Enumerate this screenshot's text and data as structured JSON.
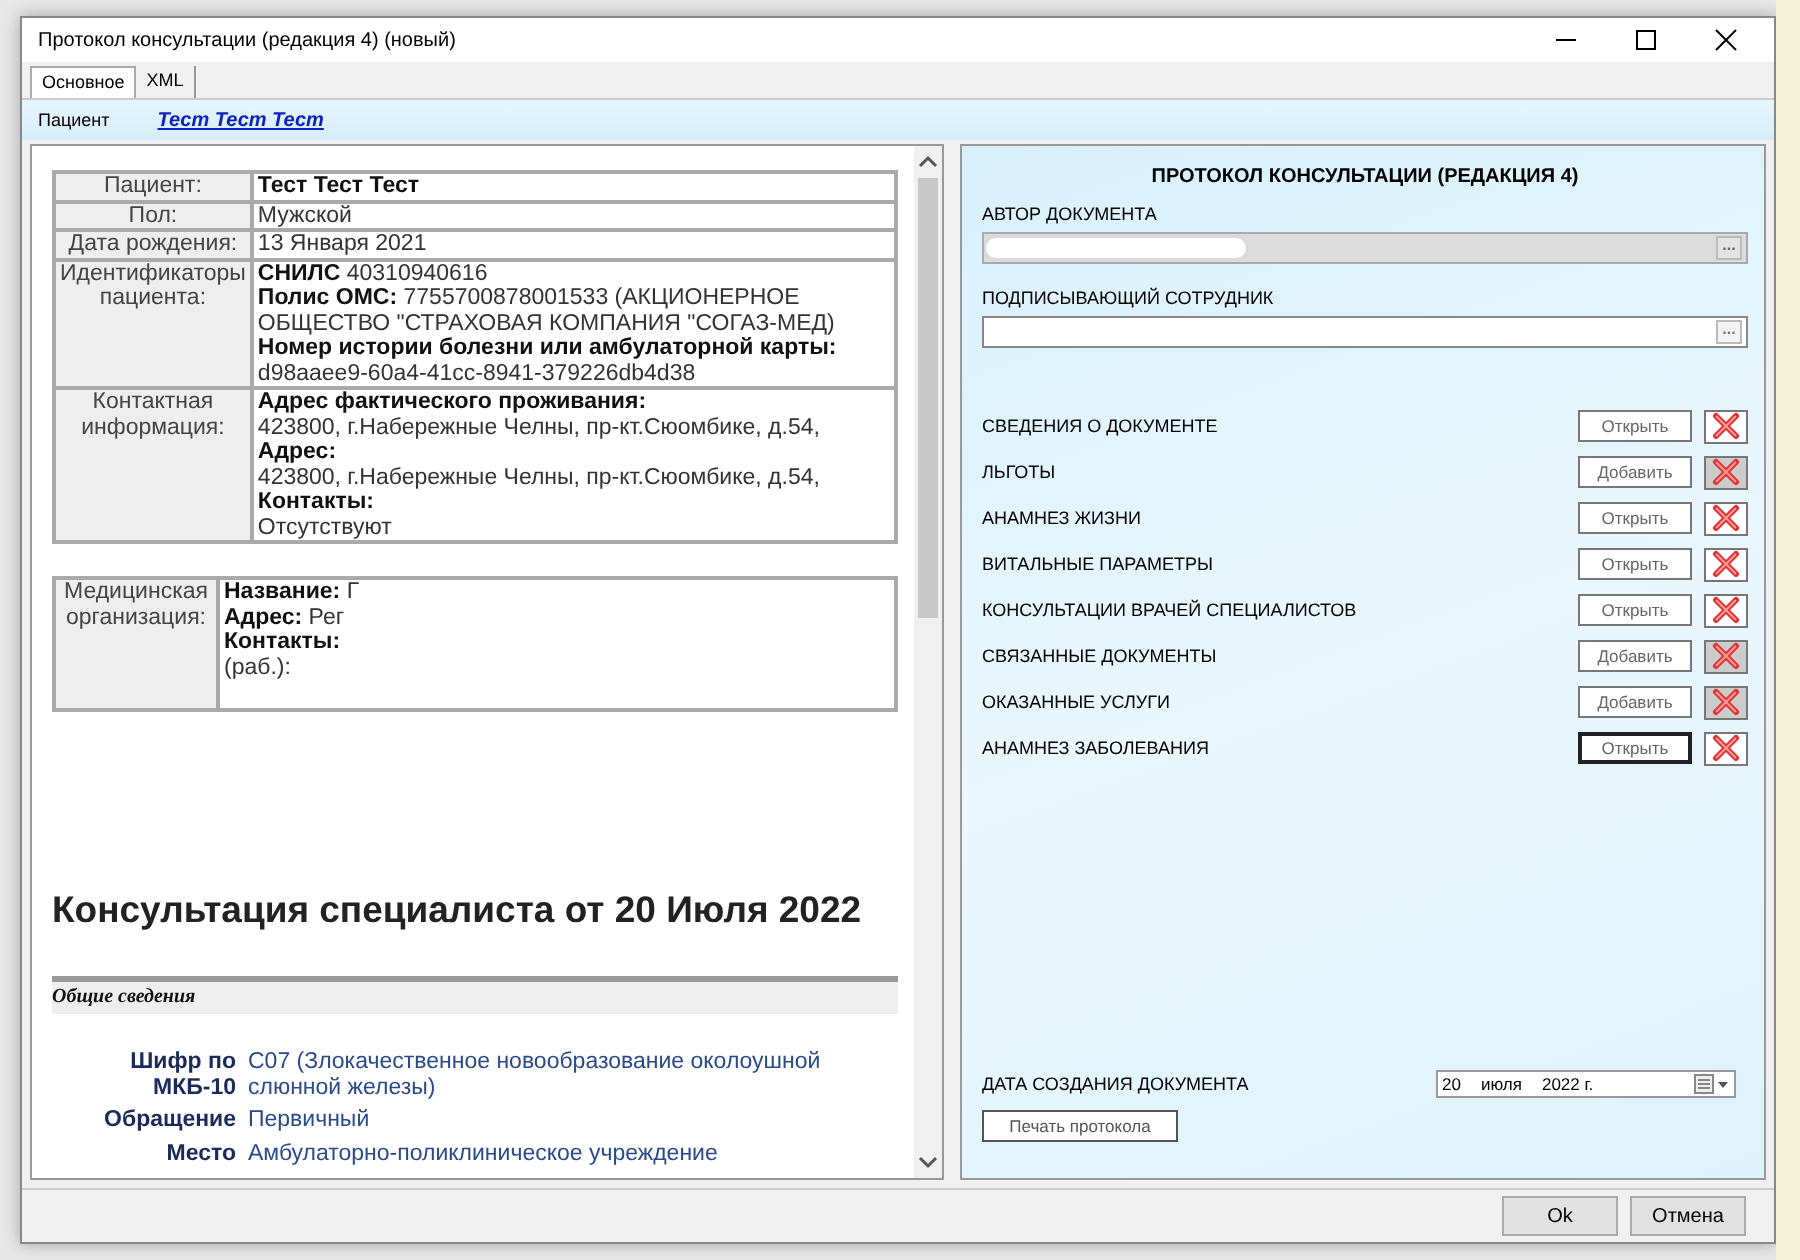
{
  "window": {
    "title": "Протокол консультации (редакция 4) (новый)"
  },
  "tabs": [
    {
      "label": "Основное",
      "selected": true
    },
    {
      "label": "XML",
      "selected": false
    }
  ],
  "patient_bar": {
    "label": "Пациент",
    "link": "Тест Тест Тест"
  },
  "document": {
    "patient_table": [
      {
        "label": "Пациент:",
        "lines": [
          "Тест Тест Тест"
        ],
        "bold": true
      },
      {
        "label": "Пол:",
        "lines": [
          "Мужской"
        ],
        "bold": false
      },
      {
        "label": "Дата рождения:",
        "lines": [
          "13 Января 2021"
        ],
        "bold": false
      },
      {
        "label": "Идентификаторы пациента:",
        "lines": [
          "**СНИЛС** 40310940616",
          "**Полис ОМС:** 7755700878001533 (АКЦИОНЕРНОЕ ОБЩЕСТВО \"СТРАХОВАЯ КОМПАНИЯ \"СОГАЗ-МЕД)",
          "**Номер истории болезни или амбулаторной карты:**",
          "d98aaee9-60a4-41cc-8941-379226db4d38"
        ],
        "bold": false
      },
      {
        "label": "Контактная информация:",
        "lines": [
          "**Адрес фактического проживания:**",
          "423800, г.Набережные Челны, пр-кт.Сюомбике, д.54,",
          "**Адрес:**",
          "423800, г.Набережные Челны, пр-кт.Сюомбике, д.54,",
          "**Контакты:**",
          "Отсутствуют"
        ],
        "bold": false
      }
    ],
    "org_table": {
      "label": "Медицинская организация:",
      "lines": [
        "**Название:** Г",
        "**Адрес:** Рег",
        "**Контакты:**",
        "(раб.):"
      ]
    },
    "heading": "Консультация специалиста от 20 Июля 2022",
    "section": "Общие сведения",
    "fields": [
      {
        "label": "Шифр по МКБ-10",
        "value": "C07 (Злокачественное новообразование околоушной слюнной железы)"
      },
      {
        "label": "Обращение",
        "value": "Первичный"
      },
      {
        "label": "Место",
        "value": "Амбулаторно-поликлиническое учреждение"
      }
    ]
  },
  "form": {
    "title": "ПРОТОКОЛ КОНСУЛЬТАЦИИ (РЕДАКЦИЯ 4)",
    "inputs": [
      {
        "label": "АВТОР ДОКУМЕНТА",
        "disabled": true,
        "button": "..."
      },
      {
        "label": "ПОДПИСЫВАЮЩИЙ СОТРУДНИК",
        "disabled": false,
        "button": "..."
      }
    ],
    "sections": [
      {
        "label": "СВЕДЕНИЯ О ДОКУМЕНТЕ",
        "action": "Открыть",
        "delete_disabled": false,
        "focused": false
      },
      {
        "label": "ЛЬГОТЫ",
        "action": "Добавить",
        "delete_disabled": true,
        "focused": false
      },
      {
        "label": "АНАМНЕЗ ЖИЗНИ",
        "action": "Открыть",
        "delete_disabled": false,
        "focused": false
      },
      {
        "label": "ВИТАЛЬНЫЕ ПАРАМЕТРЫ",
        "action": "Открыть",
        "delete_disabled": false,
        "focused": false
      },
      {
        "label": "КОНСУЛЬТАЦИИ ВРАЧЕЙ СПЕЦИАЛИСТОВ",
        "action": "Открыть",
        "delete_disabled": false,
        "focused": false
      },
      {
        "label": "СВЯЗАННЫЕ ДОКУМЕНТЫ",
        "action": "Добавить",
        "delete_disabled": true,
        "focused": false
      },
      {
        "label": "ОКАЗАННЫЕ УСЛУГИ",
        "action": "Добавить",
        "delete_disabled": true,
        "focused": false
      },
      {
        "label": "АНАМНЕЗ ЗАБОЛЕВАНИЯ",
        "action": "Открыть",
        "delete_disabled": false,
        "focused": true
      }
    ],
    "date": {
      "label": "ДАТА СОЗДАНИЯ ДОКУМЕНТА",
      "day": "20",
      "month": "июля",
      "year": "2022 г."
    },
    "print_button": "Печать протокола"
  },
  "buttons": [
    "Ok",
    "Отмена"
  ]
}
